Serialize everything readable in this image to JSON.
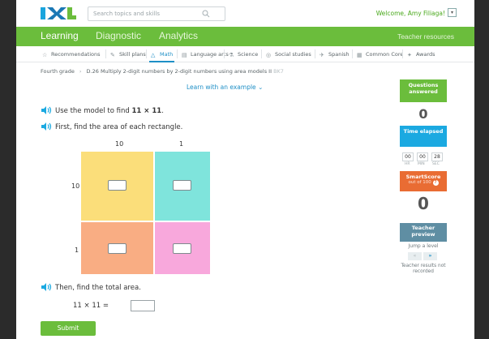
{
  "header": {
    "search_placeholder": "Search topics and skills",
    "welcome": "Welcome, Amy Filiaga!"
  },
  "nav": {
    "tabs": [
      {
        "label": "Learning",
        "active": true
      },
      {
        "label": "Diagnostic",
        "active": false
      },
      {
        "label": "Analytics",
        "active": false
      }
    ],
    "teacher_resources": "Teacher resources"
  },
  "subjects": [
    {
      "label": "Recommendations",
      "icon": "recommendations-icon"
    },
    {
      "label": "Skill plans",
      "icon": "skill-plans-icon"
    },
    {
      "label": "Math",
      "icon": "math-icon",
      "active": true
    },
    {
      "label": "Language arts",
      "icon": "language-arts-icon"
    },
    {
      "label": "Science",
      "icon": "science-icon"
    },
    {
      "label": "Social studies",
      "icon": "social-studies-icon"
    },
    {
      "label": "Spanish",
      "icon": "spanish-icon"
    },
    {
      "label": "Common Core",
      "icon": "common-core-icon"
    },
    {
      "label": "Awards",
      "icon": "awards-icon"
    }
  ],
  "breadcrumb": {
    "grade": "Fourth grade",
    "skill": "D.26 Multiply 2-digit numbers by 2-digit numbers using area models II",
    "code": "BK7"
  },
  "example_link": "Learn with an example",
  "question": {
    "line1_prefix": "Use the model to find ",
    "line1_bold": "11 × 11",
    "line1_suffix": ".",
    "line2": "First, find the area of each rectangle.",
    "line3": "Then, find the total area.",
    "equation": "11 × 11 ="
  },
  "area_model": {
    "col_labels": [
      "10",
      "1"
    ],
    "row_labels": [
      "10",
      "1"
    ],
    "colors": {
      "top_left": "#fbde7a",
      "top_right": "#7fe4dc",
      "bottom_left": "#f9ad83",
      "bottom_right": "#f8a8dc"
    }
  },
  "submit_label": "Submit",
  "sidebar": {
    "questions_answered_label": "Questions answered",
    "questions_answered_value": "0",
    "time_elapsed_label": "Time elapsed",
    "time": {
      "hr": "00",
      "min": "00",
      "sec": "28"
    },
    "time_units": {
      "hr": "HR",
      "min": "MIN",
      "sec": "SEC"
    },
    "smartscore_label": "SmartScore",
    "smartscore_sub": "out of 100",
    "smartscore_value": "0",
    "teacher_preview": "Teacher preview",
    "jump_level": "Jump a level",
    "nav_prev": "«",
    "nav_next": "»",
    "teacher_note": "Teacher results not recorded",
    "colors": {
      "green": "#6bbd3c",
      "blue": "#1ba9e1",
      "orange": "#e96c33",
      "slate": "#5f8ea3"
    }
  }
}
